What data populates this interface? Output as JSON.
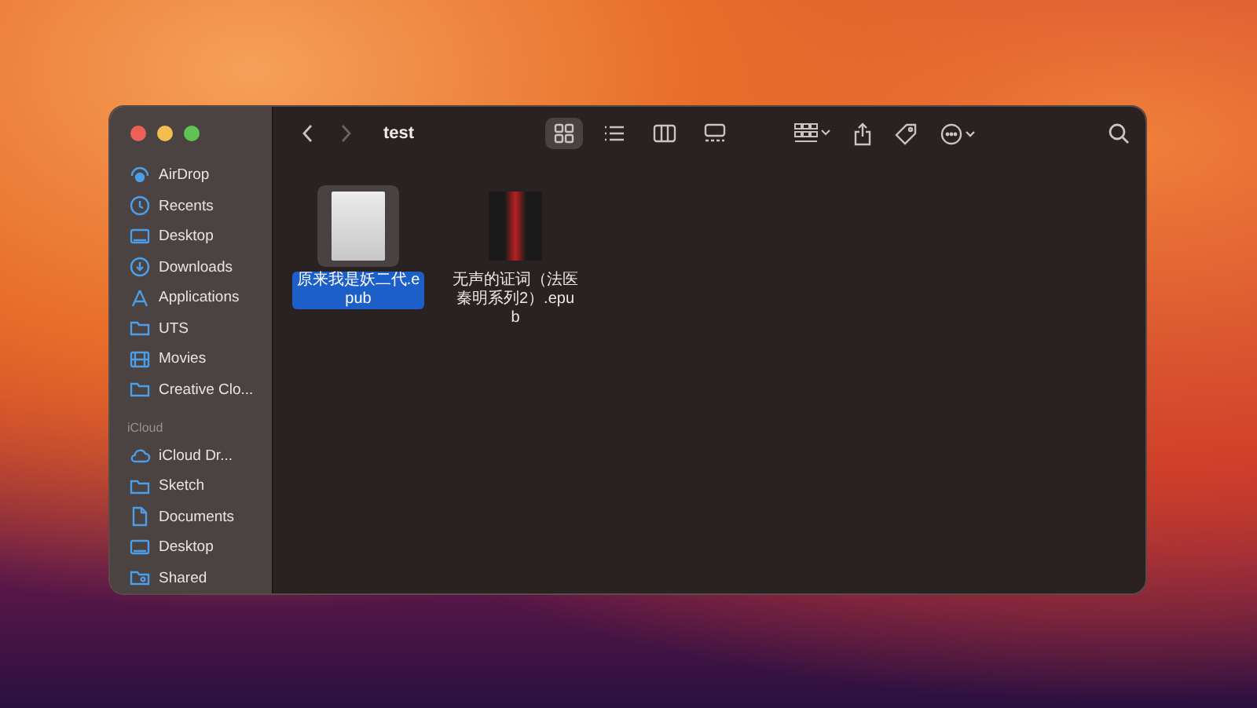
{
  "window": {
    "title": "test"
  },
  "sidebar": {
    "sections": [
      {
        "items": [
          {
            "label": "AirDrop",
            "kind": "airdrop"
          },
          {
            "label": "Recents",
            "kind": "clock"
          },
          {
            "label": "Desktop",
            "kind": "desktop"
          },
          {
            "label": "Downloads",
            "kind": "download"
          },
          {
            "label": "Applications",
            "kind": "apps"
          },
          {
            "label": "UTS",
            "kind": "folder"
          },
          {
            "label": "Movies",
            "kind": "film"
          },
          {
            "label": "Creative Clo...",
            "kind": "folder"
          }
        ]
      },
      {
        "header": "iCloud",
        "items": [
          {
            "label": "iCloud Dr...",
            "kind": "cloud"
          },
          {
            "label": "Sketch",
            "kind": "folder"
          },
          {
            "label": "Documents",
            "kind": "doc"
          },
          {
            "label": "Desktop",
            "kind": "desktop"
          },
          {
            "label": "Shared",
            "kind": "shared"
          }
        ]
      }
    ]
  },
  "view_modes": [
    {
      "kind": "icons",
      "selected": true
    },
    {
      "kind": "list",
      "selected": false
    },
    {
      "kind": "columns",
      "selected": false
    },
    {
      "kind": "gallery",
      "selected": false
    }
  ],
  "files": [
    {
      "name": "原来我是妖二代.epub",
      "selected": true,
      "kind": "light"
    },
    {
      "name": "无声的证词（法医秦明系列2）.epub",
      "selected": false,
      "kind": "dark"
    }
  ]
}
